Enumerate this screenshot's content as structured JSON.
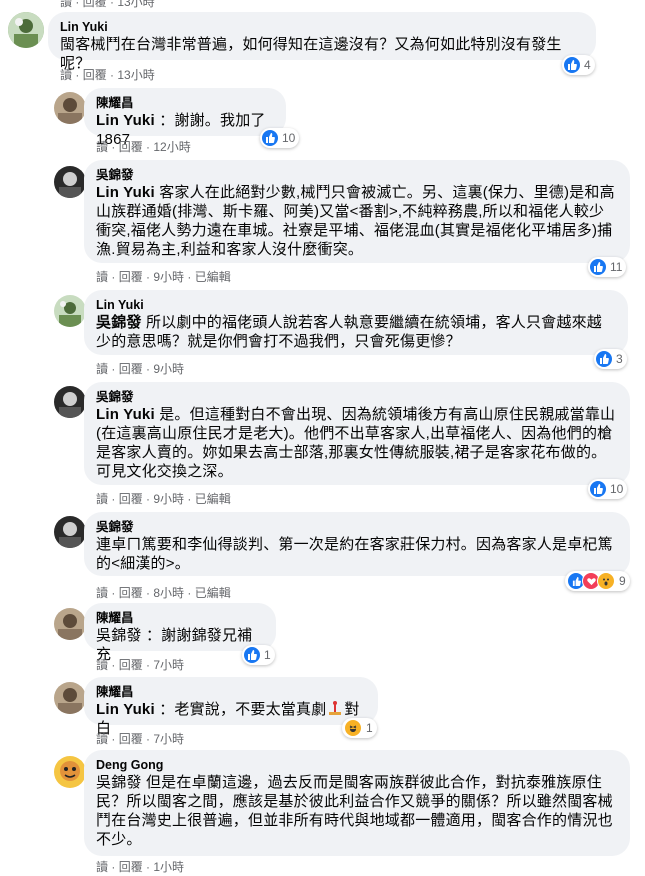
{
  "top_meta": "讀 · 回覆 · 13小時",
  "comments": [
    {
      "author": "Lin Yuki",
      "mention": "",
      "text": "閩客械鬥在台灣非常普遍，如何得知在這邊沒有？又為何如此特別沒有發生呢？",
      "meta": [
        "讀",
        "回覆",
        "13小時"
      ],
      "reactions": "4"
    },
    {
      "author": "陳耀昌",
      "mention": "Lin Yuki",
      "text": " ：謝謝。我加了1867",
      "meta": [
        "讀",
        "回覆",
        "12小時"
      ],
      "reactions": "10"
    },
    {
      "author": "吳錦發",
      "mention": "Lin Yuki",
      "text": " 客家人在此絕對少數,械鬥只會被滅亡。另、這裏(保力、里德)是和高山族群通婚(排灣、斯卡羅、阿美)又當<番割>,不純粹務農,所以和福佬人較少衝突,福佬人勢力遠在車城。社寮是平埔、福佬混血(其實是福佬化平埔居多)捕漁.貿易為主,利益和客家人沒什麼衝突。",
      "meta": [
        "讀",
        "回覆",
        "9小時",
        "已編輯"
      ],
      "reactions": "11"
    },
    {
      "author": "Lin Yuki",
      "mention": "吳錦發",
      "text": " 所以劇中的福佬頭人說若客人執意要繼續在統領埔，客人只會越來越少的意思嗎？就是你們會打不過我們，只會死傷更慘？",
      "meta": [
        "讀",
        "回覆",
        "9小時"
      ],
      "reactions": "3"
    },
    {
      "author": "吳錦發",
      "mention": "Lin Yuki",
      "text": " 是。但這種對白不會出現、因為統領埔後方有高山原住民親戚當靠山(在這裏高山原住民才是老大)。他們不出草客家人,出草福佬人、因為他們的槍是客家人賣的。妳如果去高士部落,那裏女性傳統服裝,裙子是客家花布做的。可見文化交換之深。",
      "meta": [
        "讀",
        "回覆",
        "9小時",
        "已編輯"
      ],
      "reactions": "10"
    },
    {
      "author": "吳錦發",
      "mention": "",
      "text": "連卓ㄇ篤要和李仙得談判、第一次是約在客家莊保力村。因為客家人是卓杞篤的<細漢的>。",
      "meta": [
        "讀",
        "回覆",
        "8小時",
        "已編輯"
      ],
      "reactions": "9"
    },
    {
      "author": "陳耀昌",
      "mention": "吳錦發",
      "text": " ：謝謝錦發兄補充",
      "meta": [
        "讀",
        "回覆",
        "7小時"
      ],
      "reactions": "1"
    },
    {
      "author": "陳耀昌",
      "mention": "Lin Yuki",
      "text": " ：老實說，不要太當真劇",
      "text2": "對白",
      "meta": [
        "讀",
        "回覆",
        "7小時"
      ],
      "reactions": "1"
    },
    {
      "author": "Deng Gong",
      "mention": "吳錦發",
      "text": " 但是在卓蘭這邊，過去反而是閩客兩族群彼此合作，對抗泰雅族原住民？所以閩客之間，應該是基於彼此利益合作又競爭的關係？所以雖然閩客械鬥在台灣史上很普遍，但並非所有時代與地域都一體適用，閩客合作的情況也不少。",
      "meta": [
        "讀",
        "回覆",
        "1小時"
      ],
      "reactions": ""
    }
  ],
  "colors": {
    "like": "#1877f2",
    "bubble": "#f0f2f5",
    "meta": "#65676b"
  }
}
